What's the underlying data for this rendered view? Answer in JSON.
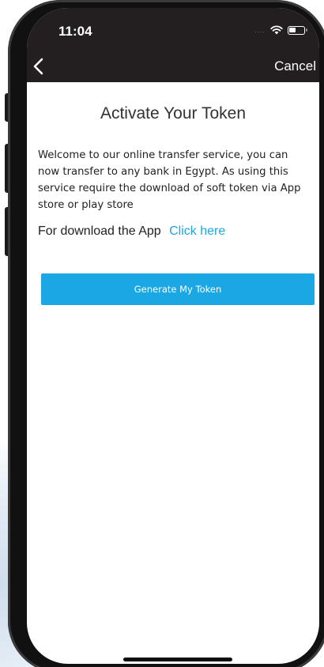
{
  "status_bar": {
    "time": "11:04",
    "signal": "....",
    "wifi_icon": "wifi-icon",
    "battery_icon": "battery-icon"
  },
  "nav": {
    "back_icon": "chevron-left-icon",
    "cancel_label": "Cancel",
    "bar_color": "#231f20"
  },
  "content": {
    "title": "Activate Your Token",
    "body": "Welcome to our online transfer service, you can now transfer to any bank in Egypt. As using this service require the download of soft token via App store or play store",
    "download_prefix": "For download the App",
    "download_link": "Click here",
    "generate_button": "Generate My Token"
  },
  "colors": {
    "accent": "#1ba7e3",
    "link": "#1ba7dc",
    "text": "#222222"
  }
}
